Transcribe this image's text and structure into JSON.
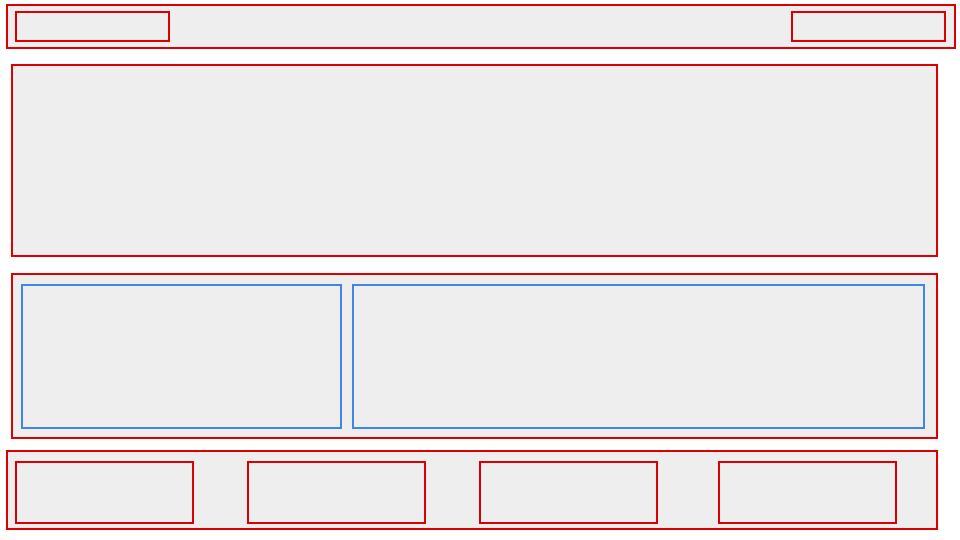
{
  "colors": {
    "region_border": "#dd0000",
    "nested_region_border": "#3f86e6",
    "region_fill": "#eeeeee",
    "page_background": "#ffffff"
  }
}
